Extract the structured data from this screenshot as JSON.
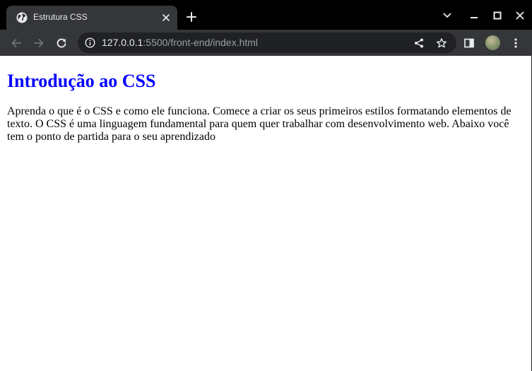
{
  "browser": {
    "tab": {
      "title": "Estrutura CSS"
    },
    "address_bar": {
      "host": "127.0.0.1",
      "path": ":5500/front-end/index.html"
    },
    "icons": {
      "favicon": "globe-icon",
      "tab_close": "close-icon",
      "new_tab": "plus-icon",
      "tab_search": "chevron-down-icon",
      "minimize": "minimize-icon",
      "maximize": "maximize-icon",
      "close_window": "close-icon",
      "back": "arrow-left-icon",
      "forward": "arrow-right-icon",
      "reload": "reload-icon",
      "site_info": "info-icon",
      "share": "share-icon",
      "bookmark": "star-icon",
      "side_panel": "side-panel-icon",
      "profile": "avatar",
      "menu": "kebab-menu-icon"
    },
    "colors": {
      "tabstrip": "#000000",
      "toolbar": "#35363a",
      "omnibox": "#202124"
    }
  },
  "page": {
    "heading": "Introdução ao CSS",
    "paragraph": "Aprenda o que é o CSS e como ele funciona. Comece a criar os seus primeiros estilos formatando elementos de texto. O CSS é uma linguagem fundamental para quem quer trabalhar com desenvolvimento web. Abaixo você tem o ponto de partida para o seu aprendizado",
    "colors": {
      "heading": "#0000ff",
      "text": "#000000",
      "background": "#ffffff"
    }
  }
}
